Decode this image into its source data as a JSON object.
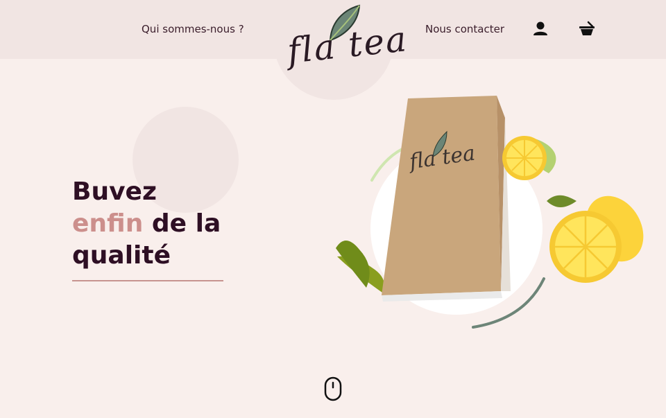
{
  "header": {
    "nav_about_label": "Qui sommes-nous ?",
    "nav_contact_label": "Nous contacter",
    "logo_text": "fla tea",
    "icons": [
      "user-icon",
      "basket-icon"
    ]
  },
  "hero": {
    "headline_line1": "Buvez",
    "headline_accent": "enfin",
    "headline_line2_rest": " de la",
    "headline_line3": "qualité",
    "product_bag_text": "fla tea"
  },
  "colors": {
    "background": "#f9efec",
    "header": "#f1e5e3",
    "heading": "#2e0f24",
    "accent": "#cc8f8c"
  },
  "scroll_indicator": "mouse-scroll-icon"
}
